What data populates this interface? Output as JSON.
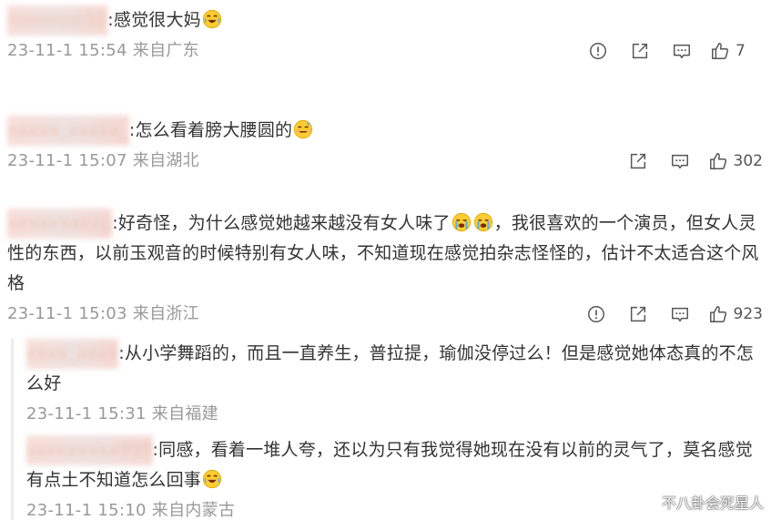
{
  "comments": [
    {
      "user": "nnnnnnn10",
      "text": ":感觉很大妈",
      "emoji": "laugh-cry",
      "meta": "23-11-1 15:54 来自广东",
      "likes": "7",
      "has_report": true
    },
    {
      "user": "xxxxx_xxxxx_",
      "text": ":怎么看着膀大腰圆的",
      "emoji": "embarrassed",
      "meta": "23-11-1 15:07 来自湖北",
      "likes": "302",
      "has_report": false
    },
    {
      "user": "xxxxxxxxxg",
      "text_a": ":好奇怪，为什么感觉她越来越没有女人味了",
      "text_b": "，我很喜欢的一个演员，但女人灵性的东西，以前玉观音的时候特别有女人味，不知道现在感觉拍杂志怪怪的，估计不太适合这个风格",
      "emoji": "crying",
      "meta": "23-11-1 15:03 来自浙江",
      "likes": "923",
      "has_report": true
    }
  ],
  "replies": [
    {
      "user": "xxxx_xxxx",
      "text": ":从小学舞蹈的，而且一直养生，普拉提，瑜伽没停过么！但是感觉她体态真的不怎么好",
      "meta": "23-11-1 15:31 来自福建"
    },
    {
      "user": "sxxxxxxxx999",
      "text": ":同感，看着一堆人夸，还以为只有我觉得她现在没有以前的灵气了，莫名感觉有点土不知道怎么回事",
      "emoji": "laugh-cry",
      "meta": "23-11-1 15:10 来自内蒙古"
    }
  ],
  "icons": {
    "report": "report-icon",
    "share": "share-icon",
    "comment": "comment-icon",
    "like": "thumbs-up-icon"
  },
  "watermark": "不八卦会死星人"
}
